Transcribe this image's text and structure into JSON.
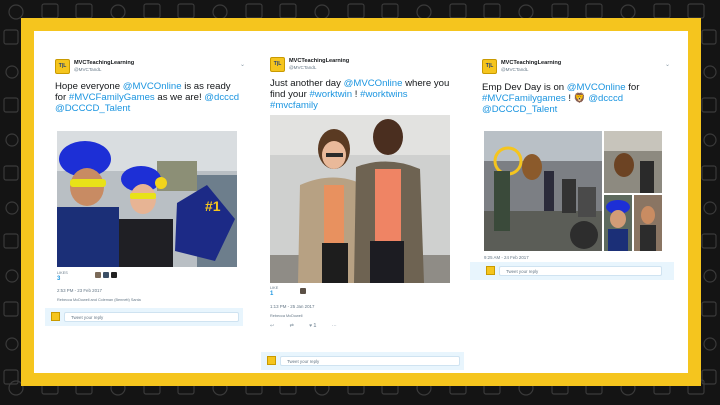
{
  "cards": [
    {
      "account_name": "MVCTeachingLearning",
      "account_handle": "@MVCTandL",
      "logo_text": "TEACHING LEARNING",
      "text_parts": [
        {
          "t": "Hope everyone ",
          "hl": false
        },
        {
          "t": "@MVCOnline",
          "hl": true
        },
        {
          "t": " is as ready for ",
          "hl": false
        },
        {
          "t": "#MVCFamilyGames",
          "hl": true
        },
        {
          "t": " as we are! ",
          "hl": false
        },
        {
          "t": "@dcccd",
          "hl": true
        },
        {
          "t": " ",
          "hl": false
        },
        {
          "t": "@DCCCD_Talent",
          "hl": true
        }
      ],
      "likes_label": "LIKES",
      "likes_count": "3",
      "timestamp": "2:53 PM - 23 Feb 2017",
      "liked_by": "Rebecca McDowell and Coleman (Bennett) Santa",
      "action_count": "3",
      "reply_placeholder": "Tweet your reply"
    },
    {
      "account_name": "MVCTeachingLearning",
      "account_handle": "@MVCTandL",
      "logo_text": "TEACHING LEARNING",
      "text_parts": [
        {
          "t": "Just another day ",
          "hl": false
        },
        {
          "t": "@MVCOnline",
          "hl": true
        },
        {
          "t": " where you find your ",
          "hl": false
        },
        {
          "t": "#worktwin",
          "hl": true
        },
        {
          "t": " ! ",
          "hl": false
        },
        {
          "t": "#worktwins",
          "hl": true
        },
        {
          "t": " ",
          "hl": false
        },
        {
          "t": "#mvcfamily",
          "hl": true
        }
      ],
      "likes_label": "LIKE",
      "likes_count": "1",
      "timestamp": "1:13 PM - 25 Jan 2017",
      "liked_by": "Rebecca McDowell",
      "action_count": "1",
      "reply_placeholder": "Tweet your reply"
    },
    {
      "account_name": "MVCTeachingLearning",
      "account_handle": "@MVCTandL",
      "logo_text": "TEACHING LEARNING",
      "text_parts": [
        {
          "t": "Emp Dev Day is on ",
          "hl": false
        },
        {
          "t": "@MVCOnline",
          "hl": true
        },
        {
          "t": " for ",
          "hl": false
        },
        {
          "t": "#MVCFamilygames",
          "hl": true
        },
        {
          "t": " ! 🦁 ",
          "hl": false
        },
        {
          "t": "@dcccd",
          "hl": true
        },
        {
          "t": " ",
          "hl": false
        },
        {
          "t": "@DCCCD_Talent",
          "hl": true
        }
      ],
      "timestamp": "9:25 AM - 24 Feb 2017",
      "reply_placeholder": "Tweet your reply"
    }
  ],
  "icons": {
    "caret": "chevron-down-icon",
    "reply": "reply-icon",
    "retweet": "retweet-icon",
    "like": "heart-icon",
    "more": "more-icon"
  },
  "colors": {
    "frame": "#f5c51e",
    "background": "#141414",
    "link": "#1b95e0",
    "reply_bar": "#e8f5fd"
  }
}
